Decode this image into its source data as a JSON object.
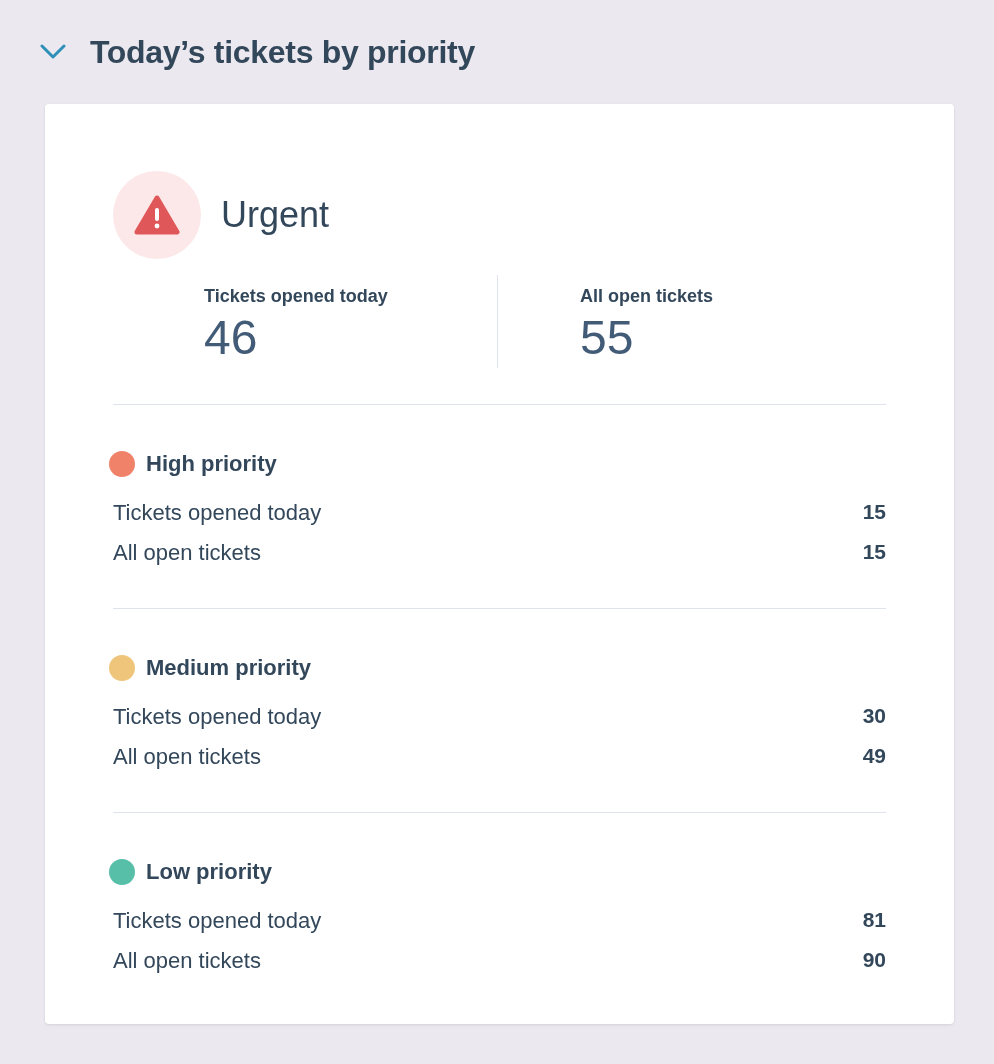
{
  "section": {
    "title": "Today’s tickets by priority",
    "expanded": true
  },
  "urgent": {
    "label": "Urgent",
    "stats": [
      {
        "label": "Tickets opened today",
        "value": "46"
      },
      {
        "label": "All open tickets",
        "value": "55"
      }
    ]
  },
  "priorities": [
    {
      "label": "High priority",
      "color": "#f0826a",
      "rows": [
        {
          "label": "Tickets opened today",
          "value": "15"
        },
        {
          "label": "All open tickets",
          "value": "15"
        }
      ]
    },
    {
      "label": "Medium priority",
      "color": "#eec57a",
      "rows": [
        {
          "label": "Tickets opened today",
          "value": "30"
        },
        {
          "label": "All open tickets",
          "value": "49"
        }
      ]
    },
    {
      "label": "Low priority",
      "color": "#57bfa8",
      "rows": [
        {
          "label": "Tickets opened today",
          "value": "81"
        },
        {
          "label": "All open tickets",
          "value": "90"
        }
      ]
    }
  ]
}
